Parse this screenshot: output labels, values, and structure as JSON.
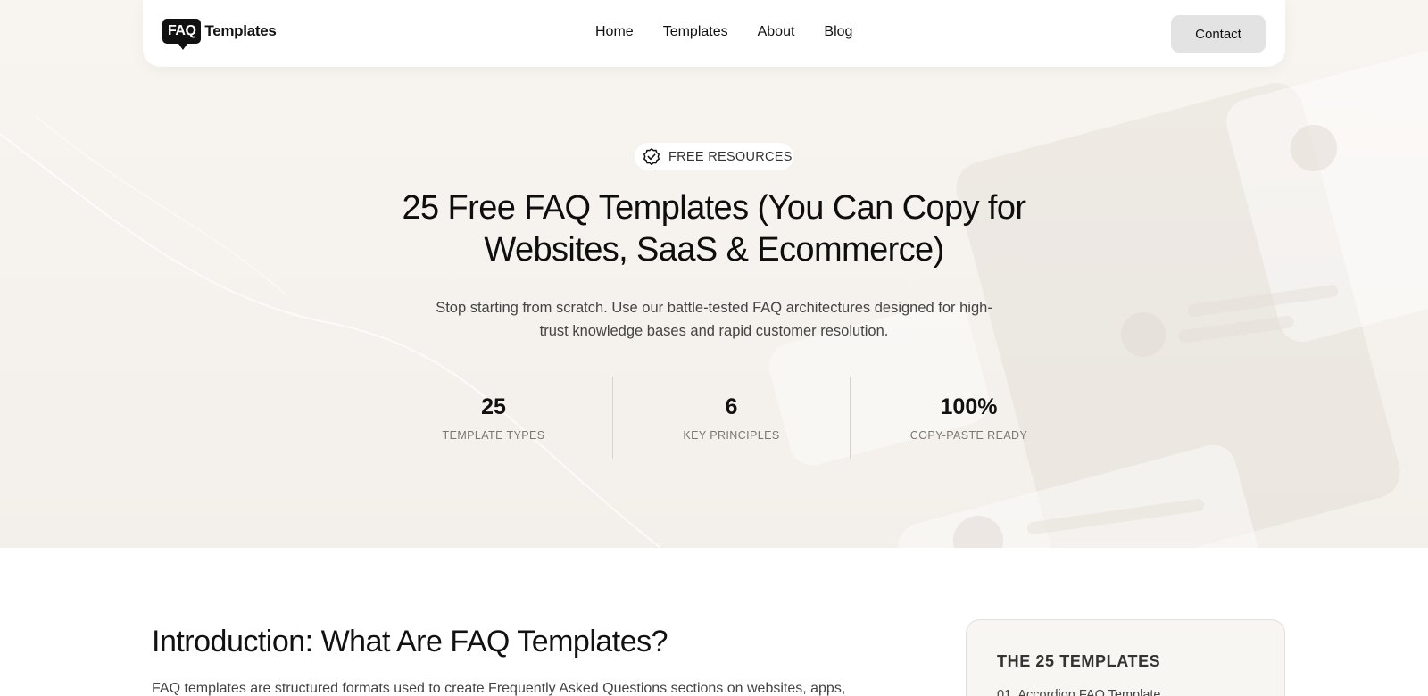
{
  "logo": {
    "badge": "FAQ",
    "text": "Templates"
  },
  "nav": {
    "links": [
      "Home",
      "Templates",
      "About",
      "Blog"
    ],
    "contact_label": "Contact"
  },
  "hero": {
    "badge": "FREE RESOURCES",
    "title_line1": "25 Free FAQ Templates (You Can Copy for",
    "title_line2": "Websites, SaaS & Ecommerce)",
    "subtitle_line1": "Stop starting from scratch. Use our battle-tested FAQ architectures designed for high-",
    "subtitle_line2": "trust knowledge bases and rapid customer resolution.",
    "stats": [
      {
        "value": "25",
        "label": "TEMPLATE TYPES"
      },
      {
        "value": "6",
        "label": "KEY PRINCIPLES"
      },
      {
        "value": "100%",
        "label": "COPY-PASTE READY"
      }
    ]
  },
  "intro": {
    "title": "Introduction: What Are FAQ Templates?",
    "text": "FAQ templates are structured formats used to create Frequently Asked Questions sections on websites, apps,"
  },
  "toc": {
    "title": "THE 25 TEMPLATES",
    "first_item": "01. Accordion FAQ Template"
  },
  "colors": {
    "hero_bg": "#f5f1ec",
    "text_primary": "#111111",
    "contact_bg": "#e3e3e3"
  },
  "icons": {
    "badge_icon": "verified-badge-icon"
  }
}
